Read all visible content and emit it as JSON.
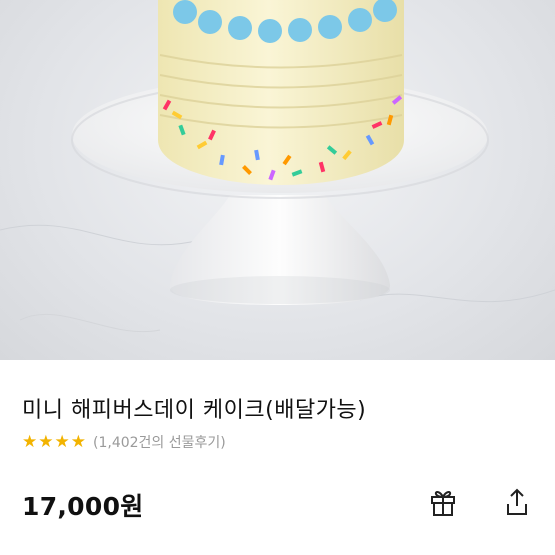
{
  "product": {
    "title": "미니 해피버스데이 케이크(배달가능)",
    "rating_stars": 4,
    "review_text": "(1,402건의 선물후기)",
    "price": "17,000원"
  },
  "actions": {
    "gift_icon": "gift-icon",
    "share_icon": "share-icon"
  },
  "colors": {
    "star": "#f2b300",
    "review_text": "#9a9a9a",
    "title": "#111111"
  }
}
